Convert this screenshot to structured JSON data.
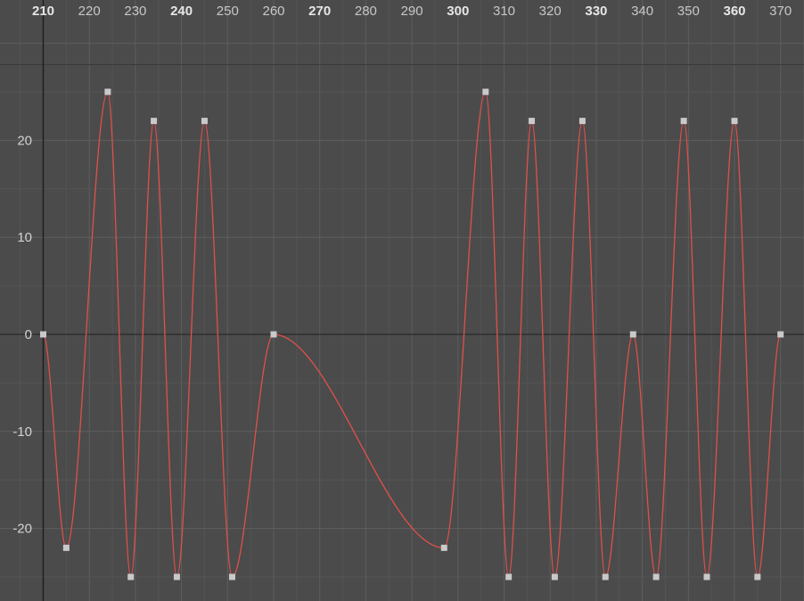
{
  "graph_editor": {
    "frame_ruler": {
      "labels": [
        "210",
        "220",
        "230",
        "240",
        "250",
        "260",
        "270",
        "280",
        "290",
        "300",
        "310",
        "320",
        "330",
        "340",
        "350",
        "360",
        "370"
      ],
      "major_frames": [
        210,
        240,
        270,
        300,
        330,
        360
      ]
    },
    "value_ruler": {
      "labels": [
        "20",
        "10",
        "0",
        "-10",
        "-20"
      ]
    }
  },
  "chart_data": {
    "type": "line",
    "title": "",
    "xlabel": "",
    "ylabel": "",
    "xlim": [
      208,
      375
    ],
    "ylim": [
      -25,
      25
    ],
    "x_ticks": [
      210,
      220,
      230,
      240,
      250,
      260,
      270,
      280,
      290,
      300,
      310,
      320,
      330,
      340,
      350,
      360,
      370
    ],
    "y_ticks": [
      20,
      10,
      0,
      -10,
      -20
    ],
    "grid": true,
    "colors": {
      "background": "#4b4b4b",
      "grid_major": "#5e5e5e",
      "grid_minor": "#545454",
      "zero_line": "#2a2a2a",
      "curve": "#e0504a",
      "keyframe": "#c9c9c9"
    },
    "series": [
      {
        "keyframes": [
          [
            210,
            0
          ],
          [
            215,
            -22
          ],
          [
            224,
            25
          ],
          [
            229,
            -25
          ],
          [
            234,
            22
          ],
          [
            239,
            -25
          ],
          [
            245,
            22
          ],
          [
            251,
            -25
          ],
          [
            260,
            0
          ],
          [
            297,
            -22
          ],
          [
            306,
            25
          ],
          [
            311,
            -25
          ],
          [
            316,
            22
          ],
          [
            321,
            -25
          ],
          [
            327,
            22
          ],
          [
            332,
            -25
          ],
          [
            338,
            0
          ],
          [
            343,
            -25
          ],
          [
            349,
            22
          ],
          [
            354,
            -25
          ],
          [
            360,
            22
          ],
          [
            365,
            -25
          ],
          [
            370,
            0
          ]
        ]
      }
    ]
  }
}
